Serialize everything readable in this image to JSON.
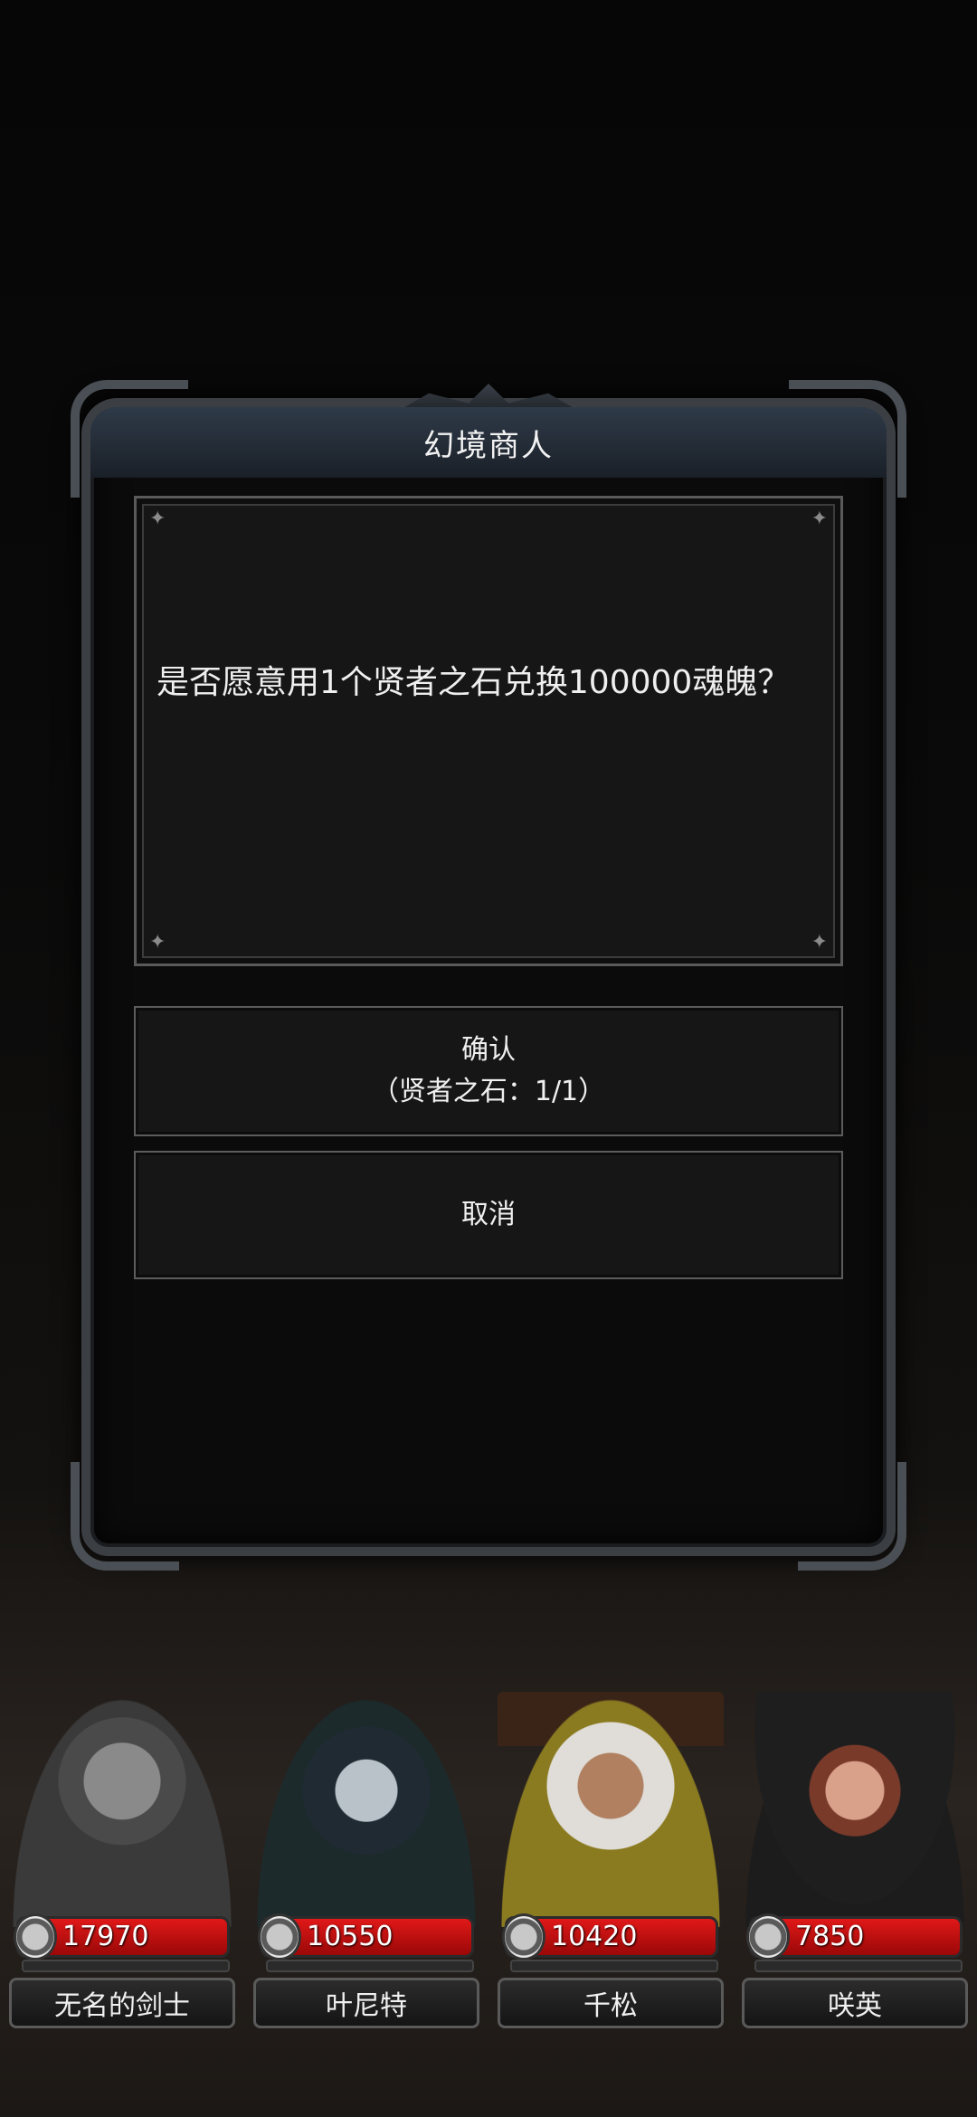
{
  "dialog": {
    "title": "幻境商人",
    "message": "是否愿意用1个贤者之石兑换100000魂魄？",
    "confirm_label": "确认",
    "confirm_sub": "（贤者之石：1/1）",
    "cancel_label": "取消"
  },
  "party": {
    "members": [
      {
        "name": "无名的剑士",
        "hp": "17970"
      },
      {
        "name": "叶尼特",
        "hp": "10550"
      },
      {
        "name": "千松",
        "hp": "10420"
      },
      {
        "name": "咲英",
        "hp": "7850"
      }
    ]
  },
  "colors": {
    "hp_bar": "#d01010",
    "title_bar": "#2f3a48",
    "frame": "#3b3f44"
  }
}
